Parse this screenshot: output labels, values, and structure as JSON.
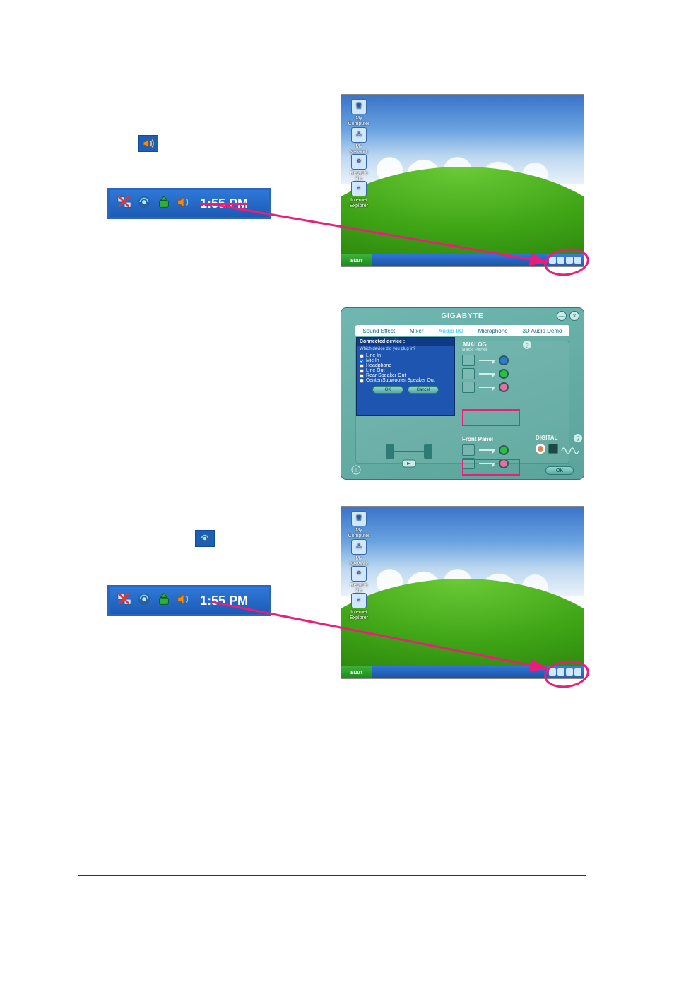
{
  "icons": {
    "audio_small_name": "sound-manager-icon",
    "ac97_small_name": "ac97-audio-icon"
  },
  "systray_top": {
    "time": "1:55 PM",
    "icons": [
      "network-disconnected-icon",
      "ac97-audio-icon",
      "safely-remove-icon",
      "sound-manager-icon"
    ]
  },
  "systray_bottom": {
    "time": "1:55 PM",
    "icons": [
      "network-disconnected-icon",
      "ac97-audio-icon",
      "safely-remove-icon",
      "sound-manager-icon"
    ]
  },
  "desktop": {
    "start_label": "start",
    "icons": [
      {
        "label": "My Computer"
      },
      {
        "label": "My Network Places"
      },
      {
        "label": "Recycle Bin"
      },
      {
        "label": "Internet Explorer"
      }
    ]
  },
  "audio_panel": {
    "brand": "GIGABYTE",
    "tabs": [
      "Sound Effect",
      "Mixer",
      "Audio I/O",
      "Microphone",
      "3D Audio Demo"
    ],
    "active_tab": "Audio I/O",
    "analog_label": "ANALOG",
    "back_panel_label": "Back Panel",
    "front_panel_label": "Front Panel",
    "digital_label": "DIGITAL",
    "help_icon": "?",
    "window_buttons": [
      "—",
      "×"
    ],
    "ok_label": "OK",
    "footnote": "©"
  },
  "device_dialog": {
    "title": "Connected device :",
    "question": "Which device did you plug in?",
    "options": [
      {
        "label": "Line In"
      },
      {
        "label": "Mic In",
        "checked": true
      },
      {
        "label": "Headphone"
      },
      {
        "label": "Line Out"
      },
      {
        "label": "Rear Speaker Out"
      },
      {
        "label": "Center/Subwoofer Speaker Out"
      }
    ],
    "ok_label": "OK",
    "cancel_label": "Cancel"
  },
  "callouts": {
    "arrow_color": "#e91e7a"
  }
}
